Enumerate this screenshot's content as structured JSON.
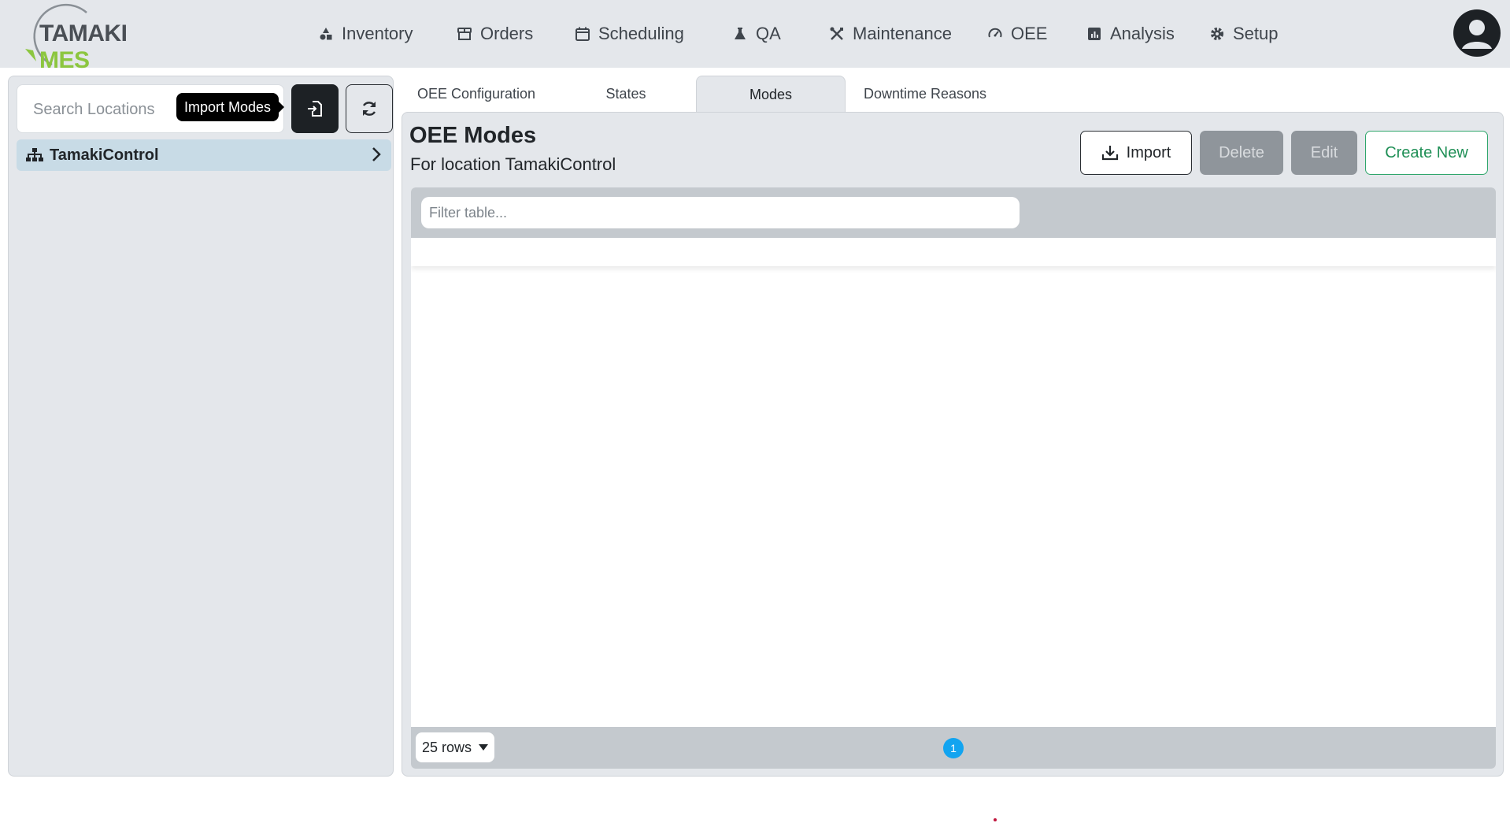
{
  "app": {
    "logo_word1": "TAMAKI",
    "logo_word2": "MES",
    "brand_green": "#8cc63f",
    "brand_gray": "#4a4f55"
  },
  "nav": {
    "items": [
      {
        "label": "Inventory",
        "icon": "shapes-icon"
      },
      {
        "label": "Orders",
        "icon": "store-icon"
      },
      {
        "label": "Scheduling",
        "icon": "calendar-icon"
      },
      {
        "label": "QA",
        "icon": "flask-icon"
      },
      {
        "label": "Maintenance",
        "icon": "tools-icon"
      },
      {
        "label": "OEE",
        "icon": "gauge-icon"
      },
      {
        "label": "Analysis",
        "icon": "chart-square-icon"
      },
      {
        "label": "Setup",
        "icon": "gear-icon"
      }
    ]
  },
  "sidebar": {
    "search_placeholder": "Search Locations",
    "tooltip": "Import Modes",
    "tree": [
      {
        "label": "TamakiControl",
        "icon": "sitemap-icon"
      }
    ]
  },
  "tabs": [
    {
      "label": "OEE Configuration",
      "active": false
    },
    {
      "label": "States",
      "active": false
    },
    {
      "label": "Modes",
      "active": true
    },
    {
      "label": "Downtime Reasons",
      "active": false
    }
  ],
  "main": {
    "title": "OEE Modes",
    "subtitle": "For location TamakiControl",
    "buttons": {
      "import": "Import",
      "delete": "Delete",
      "edit": "Edit",
      "create": "Create New"
    },
    "filter_placeholder": "Filter table...",
    "rows_per_page": "25 rows",
    "current_page": "1"
  },
  "colors": {
    "accent_blue": "#12a4f0",
    "create_green": "#2fa66b",
    "tree_selected": "#c8dbe6"
  }
}
